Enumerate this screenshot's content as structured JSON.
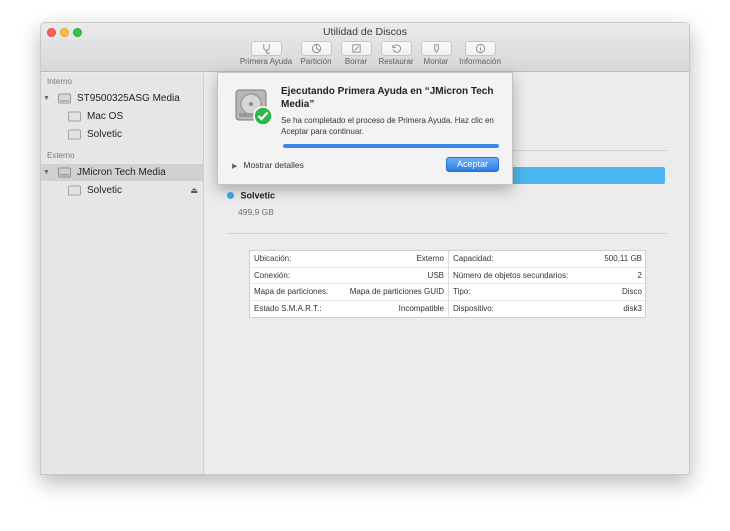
{
  "window": {
    "title": "Utilidad de Discos"
  },
  "toolbar": {
    "items": [
      {
        "label": "Primera Ayuda",
        "icon": "stethoscope-icon"
      },
      {
        "label": "Partición",
        "icon": "partition-icon"
      },
      {
        "label": "Borrar",
        "icon": "erase-icon"
      },
      {
        "label": "Restaurar",
        "icon": "restore-icon"
      },
      {
        "label": "Montar",
        "icon": "mount-icon"
      },
      {
        "label": "Información",
        "icon": "info-icon"
      }
    ]
  },
  "sidebar": {
    "internal_header": "Interno",
    "external_header": "Externo",
    "internal_disk": "ST9500325ASG Media",
    "internal_volumes": [
      "Mac OS",
      "Solvetic"
    ],
    "external_disk": "JMicron Tech Media",
    "external_volumes": [
      "Solvetic"
    ],
    "eject_symbol": "⏏"
  },
  "volume": {
    "name": "Solvetic",
    "size": "499,9 GB",
    "color": "#3fa9ec"
  },
  "info_table": {
    "left": [
      {
        "key": "Ubicación:",
        "value": "Externo"
      },
      {
        "key": "Conexión:",
        "value": "USB"
      },
      {
        "key": "Mapa de particiones:",
        "value": "Mapa de particiones GUID"
      },
      {
        "key": "Estado S.M.A.R.T.:",
        "value": "Incompatible"
      }
    ],
    "right": [
      {
        "key": "Capacidad:",
        "value": "500,11 GB"
      },
      {
        "key": "Número de objetos secundarios:",
        "value": "2"
      },
      {
        "key": "Tipo:",
        "value": "Disco"
      },
      {
        "key": "Dispositivo:",
        "value": "disk3"
      }
    ]
  },
  "dialog": {
    "title": "Ejecutando Primera Ayuda en “JMicron Tech Media”",
    "message": "Se ha completado el proceso de Primera Ayuda. Haz clic en Aceptar para continuar.",
    "progress": 1.0,
    "details_label": "Mostrar detalles",
    "details_arrow": "▶",
    "accept_label": "Aceptar"
  },
  "colors": {
    "accent": "#3a87e4",
    "usage_bar": "#4cb6f0"
  }
}
